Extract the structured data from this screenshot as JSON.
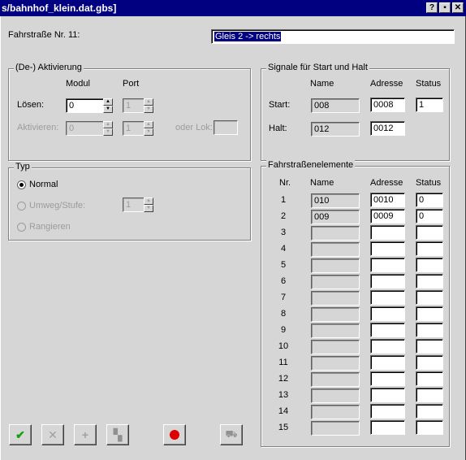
{
  "window": {
    "title": "s/bahnhof_klein.dat.gbs]",
    "buttons": [
      "?",
      "▪",
      "✕"
    ]
  },
  "route": {
    "label": "Fahrstraße Nr. 11:",
    "name_value": "Gleis 2 -> rechts"
  },
  "activation": {
    "title": "(De-) Aktivierung",
    "col_modul": "Modul",
    "col_port": "Port",
    "loesen_label": "Lösen:",
    "loesen_modul": "0",
    "loesen_port": "1",
    "aktivieren_label": "Aktivieren:",
    "aktivieren_modul": "0",
    "aktivieren_port": "1",
    "oder_lok_label": "oder Lok:",
    "oder_lok_value": ""
  },
  "signals": {
    "title": "Signale für Start und Halt",
    "col_name": "Name",
    "col_adresse": "Adresse",
    "col_status": "Status",
    "start_label": "Start:",
    "start_name": "008",
    "start_adresse": "0008",
    "start_status": "1",
    "halt_label": "Halt:",
    "halt_name": "012",
    "halt_adresse": "0012"
  },
  "typ": {
    "title": "Typ",
    "normal": "Normal",
    "umweg": "Umweg/Stufe:",
    "umweg_value": "1",
    "rangieren": "Rangieren"
  },
  "elements": {
    "title": "Fahrstraßenelemente",
    "col_nr": "Nr.",
    "col_name": "Name",
    "col_adresse": "Adresse",
    "col_status": "Status",
    "rows": [
      {
        "nr": "1",
        "name": "010",
        "adresse": "0010",
        "status": "0"
      },
      {
        "nr": "2",
        "name": "009",
        "adresse": "0009",
        "status": "0"
      },
      {
        "nr": "3",
        "name": "",
        "adresse": "",
        "status": ""
      },
      {
        "nr": "4",
        "name": "",
        "adresse": "",
        "status": ""
      },
      {
        "nr": "5",
        "name": "",
        "adresse": "",
        "status": ""
      },
      {
        "nr": "6",
        "name": "",
        "adresse": "",
        "status": ""
      },
      {
        "nr": "7",
        "name": "",
        "adresse": "",
        "status": ""
      },
      {
        "nr": "8",
        "name": "",
        "adresse": "",
        "status": ""
      },
      {
        "nr": "9",
        "name": "",
        "adresse": "",
        "status": ""
      },
      {
        "nr": "10",
        "name": "",
        "adresse": "",
        "status": ""
      },
      {
        "nr": "11",
        "name": "",
        "adresse": "",
        "status": ""
      },
      {
        "nr": "12",
        "name": "",
        "adresse": "",
        "status": ""
      },
      {
        "nr": "13",
        "name": "",
        "adresse": "",
        "status": ""
      },
      {
        "nr": "14",
        "name": "",
        "adresse": "",
        "status": ""
      },
      {
        "nr": "15",
        "name": "",
        "adresse": "",
        "status": ""
      }
    ]
  },
  "toolbar": {
    "icons": [
      "check-icon",
      "delete-icon",
      "add-icon",
      "copy-icon",
      "record-icon",
      "locomotive-icon"
    ],
    "colors": {
      "check": "#10a010",
      "record": "#e00000"
    }
  }
}
